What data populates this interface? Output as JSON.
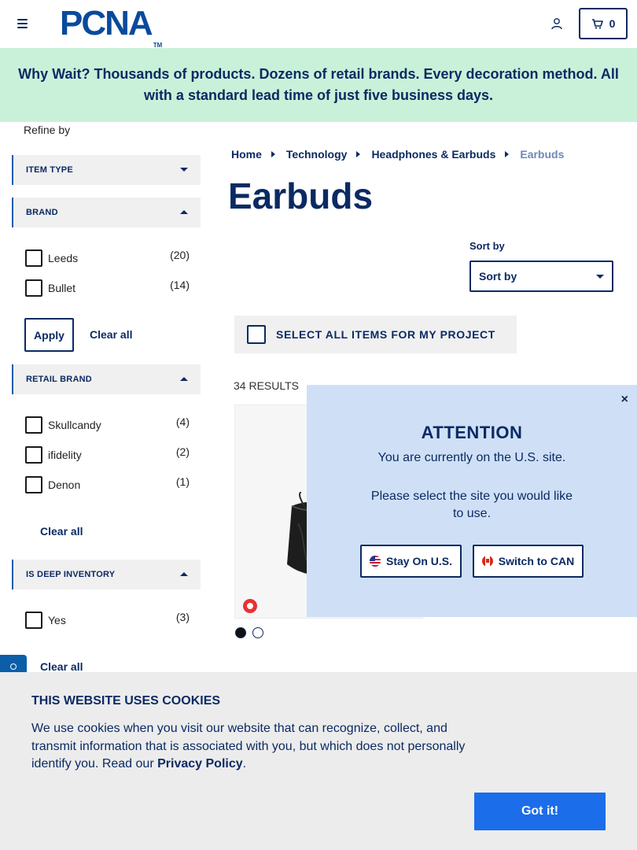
{
  "header": {
    "logo_text": "PCNA",
    "logo_tm": "TM",
    "cart_count": "0"
  },
  "promo": {
    "text": "Why Wait? Thousands of products. Dozens of retail brands. Every decoration method. All with a standard lead time of just five business days."
  },
  "sidebar": {
    "refine_label": "Refine by",
    "facets": {
      "item_type": "ITEM TYPE",
      "brand": "BRAND",
      "retail_brand": "RETAIL BRAND",
      "deep_inventory": "IS DEEP INVENTORY"
    },
    "brand_options": [
      {
        "label": "Leeds",
        "count": "(20)"
      },
      {
        "label": "Bullet",
        "count": "(14)"
      }
    ],
    "retail_brand_options": [
      {
        "label": "Skullcandy",
        "count": "(4)"
      },
      {
        "label": "ifidelity",
        "count": "(2)"
      },
      {
        "label": "Denon",
        "count": "(1)"
      }
    ],
    "deep_inventory_options": [
      {
        "label": "Yes",
        "count": "(3)"
      }
    ],
    "apply_label": "Apply",
    "clear_all_label": "Clear all"
  },
  "breadcrumb": [
    "Home",
    "Technology",
    "Headphones & Earbuds",
    "Earbuds"
  ],
  "page_title": "Earbuds",
  "sort": {
    "label": "Sort by",
    "selected": "Sort by"
  },
  "select_all_label": "SELECT ALL ITEMS FOR MY PROJECT",
  "results_count": "34 RESULTS",
  "swatches": [
    "#111111",
    "#ffffff"
  ],
  "modal": {
    "close": "×",
    "title": "ATTENTION",
    "line1": "You are currently on the U.S. site.",
    "line2": "Please select the site you would like to use.",
    "stay_label": "Stay On U.S.",
    "switch_label": "Switch to CAN"
  },
  "cookie": {
    "title": "THIS WEBSITE USES COOKIES",
    "text": "We use cookies when you visit our website that can recognize, collect, and transmit information that is associated with you, but which does not personally identify you. Read our",
    "policy_link": "Privacy Policy",
    "period": ".",
    "button": "Got it!"
  },
  "colors": {
    "brand_navy": "#0b2a63",
    "promo_bg": "#c9f1d9",
    "modal_bg": "#cfe0f6",
    "cta_blue": "#1b6dea"
  }
}
